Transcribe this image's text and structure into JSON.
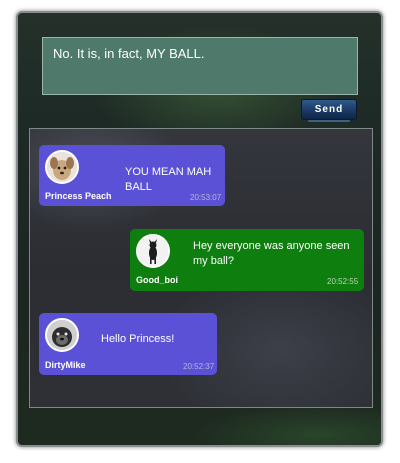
{
  "composer": {
    "value": "No. It is, in fact, MY BALL."
  },
  "send_label": "Send",
  "messages": [
    {
      "sender": "Princess Peach",
      "text": "YOU MEAN MAH BALL",
      "time": "20:53:07",
      "color": "#5b51d6",
      "avatar_icon": "princess-peach-avatar-dog-icon"
    },
    {
      "sender": "Good_boi",
      "text": "Hey everyone was anyone seen my ball?",
      "time": "20:52:55",
      "color": "#0e7e0e",
      "avatar_icon": "good-boi-avatar-dog-icon"
    },
    {
      "sender": "DirtyMike",
      "text": "Hello Princess!",
      "time": "20:52:37",
      "color": "#5b51d6",
      "avatar_icon": "dirtymike-avatar-dog-icon"
    }
  ]
}
